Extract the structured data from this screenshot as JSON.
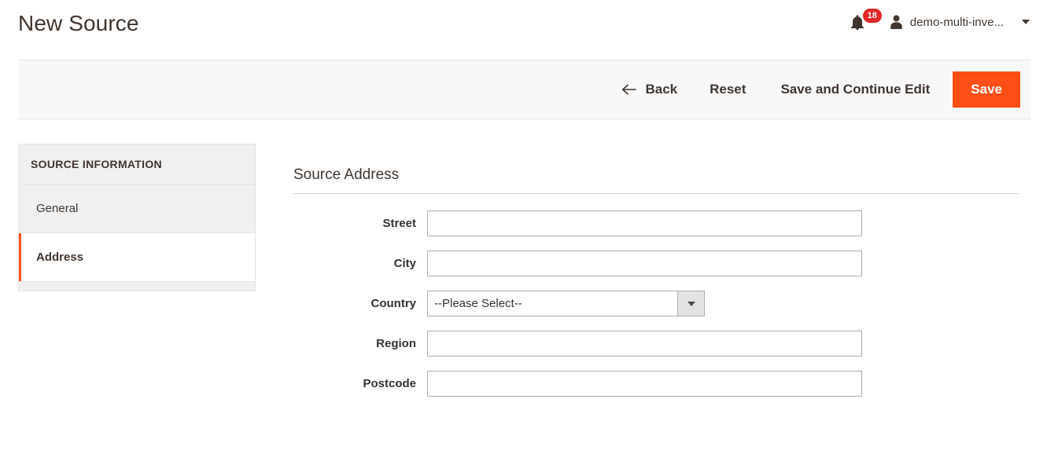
{
  "header": {
    "title": "New Source",
    "notifications": {
      "icon": "bell-icon",
      "count": "18"
    },
    "user": {
      "icon": "user-icon",
      "name": "demo-multi-inve...",
      "caret": "chevron-down-icon"
    }
  },
  "toolbar": {
    "back_label": "Back",
    "back_icon": "arrow-left-icon",
    "reset_label": "Reset",
    "save_continue_label": "Save and Continue Edit",
    "save_label": "Save",
    "primary_color": "#ff4f17"
  },
  "sidebar": {
    "title": "SOURCE INFORMATION",
    "items": [
      {
        "label": "General",
        "active": false
      },
      {
        "label": "Address",
        "active": true
      }
    ],
    "active_indicator_color": "#ff4f17"
  },
  "content": {
    "fieldset_title": "Source Address",
    "fields": [
      {
        "label": "Street",
        "type": "text",
        "value": "",
        "placeholder": ""
      },
      {
        "label": "City",
        "type": "text",
        "value": "",
        "placeholder": ""
      },
      {
        "label": "Country",
        "type": "select",
        "value": "--Please Select--"
      },
      {
        "label": "Region",
        "type": "text",
        "value": "",
        "placeholder": ""
      },
      {
        "label": "Postcode",
        "type": "text",
        "value": "",
        "placeholder": ""
      }
    ]
  }
}
